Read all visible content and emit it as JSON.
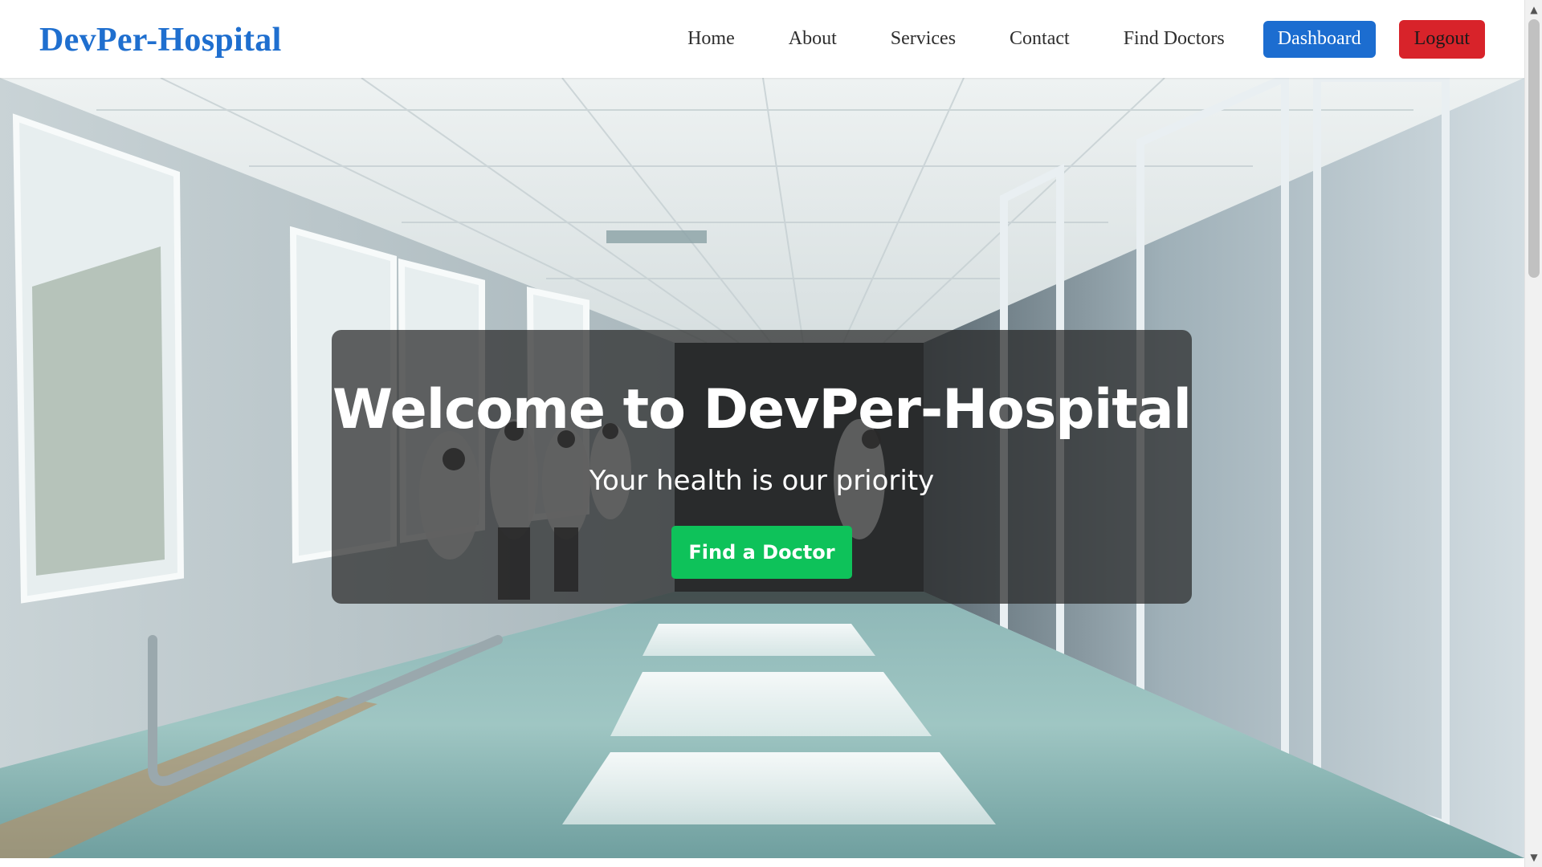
{
  "navbar": {
    "brand": "DevPer-Hospital",
    "links": [
      {
        "label": "Home"
      },
      {
        "label": "About"
      },
      {
        "label": "Services"
      },
      {
        "label": "Contact"
      },
      {
        "label": "Find Doctors"
      }
    ],
    "dashboard_label": "Dashboard",
    "logout_label": "Logout"
  },
  "hero": {
    "title": "Welcome to DevPer-Hospital",
    "subtitle": "Your health is our priority",
    "cta_label": "Find a Doctor",
    "background_image": "hospital-corridor-photo"
  },
  "colors": {
    "brand": "#1f6fcf",
    "dashboard_button": "#1c6dd0",
    "logout_button": "#d8232a",
    "cta_button": "#0ec25a",
    "overlay": "rgba(40,40,40,0.72)"
  },
  "scrollbar": {
    "up_icon": "chevron-up-icon",
    "down_icon": "chevron-down-icon"
  }
}
